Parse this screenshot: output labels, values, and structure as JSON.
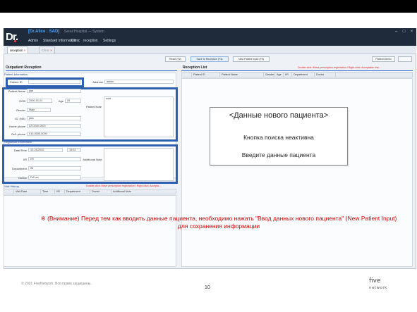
{
  "app": {
    "logo": "Dr.",
    "title": "[Dr.Alice : SAD]",
    "subtitle": "Seoul Hospital — System",
    "menu": [
      "Admin",
      "Standard Information",
      "Clinic",
      "reception",
      "Settings"
    ],
    "tabs": [
      "reception",
      "Clinic"
    ]
  },
  "toolbar": {
    "reset": "Reset (F2)",
    "save": "Save to Reception (F3)",
    "new_patient": "New Patient Input (F5)",
    "patient_memo": "Patient Memo"
  },
  "outpatient": {
    "title": "Outpatient Reception",
    "patient_info": "Patient Information",
    "patient_id_label": "Patient ID",
    "address_label": "Address",
    "address_value": "admin",
    "patient_name_label": "Patient Name",
    "patient_name_value": "jtaa",
    "dob_label": "DOB",
    "dob_value": "2000-01-01",
    "age_label": "Age",
    "age_value": "20",
    "gender_label": "Gender",
    "gender_value": "Male",
    "idno_label": "ID. (NR)",
    "idno_value": "jaks",
    "homephone_label": "Home phone",
    "homephone_value": "02-0000-0000",
    "cellphone_label": "Cell. phone",
    "cellphone_value": "010-0000-0000",
    "patient_note_label": "Patient Note",
    "patient_note_value": "note",
    "registrant_info": "Registrant information",
    "datetime_label": "Date/Time",
    "datetime_value": "10-25-2020",
    "time_value": "15:03",
    "ir_label": "I/R",
    "ir_value": "I/R",
    "department_label": "Department",
    "department_value": "IM",
    "doctor_label": "Doctor",
    "doctor_value": "DrFore",
    "additional_note_label": "Additional Note",
    "visit_history": "Visit History",
    "visit_columns": [
      "Visit Date",
      "Time",
      "I/R",
      "Department",
      "Doctor",
      "Additional Note"
    ],
    "visit_hint": "Double-click: Move prescription registration / Right-click: Accepta..."
  },
  "reception_list": {
    "title": "Reception List",
    "hint": "Double-click: Move prescription registration / Right-click: Acceptable cha...",
    "columns": [
      "Patient ID",
      "Patient Name",
      "Gender",
      "Age",
      "I/R",
      "Department",
      "Doctor"
    ]
  },
  "callout": {
    "title": "<Данные нового пациента>",
    "line1": "Кнопка поиска неактивна",
    "line2": "Введите данные пациента"
  },
  "note": "※ (Внимание) Перед тем как вводить данные пациента, необходимо нажать \"Ввод данных нового пациента\" (New Patient Input) для сохранения информации",
  "footer": {
    "copyright": "© 2021 FiveNetwork. Все права защищены.",
    "page": "10",
    "brand_top": "five",
    "brand_bottom": "network"
  }
}
